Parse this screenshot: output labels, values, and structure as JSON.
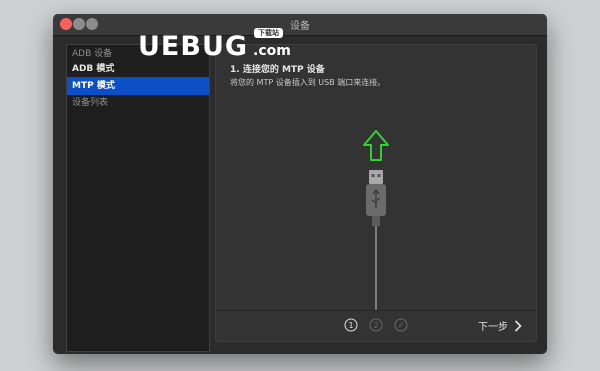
{
  "window": {
    "title": "设备"
  },
  "sidebar": {
    "items": [
      {
        "label": "ADB 设备",
        "style": "header"
      },
      {
        "label": "ADB 模式",
        "style": "bold"
      },
      {
        "label": "MTP 模式",
        "style": "selected"
      },
      {
        "label": "设备列表",
        "style": "header"
      }
    ]
  },
  "main": {
    "step_title": "1. 连接您的 MTP 设备",
    "step_description": "将您的 MTP 设备插入到 USB 端口来连接。"
  },
  "footer": {
    "steps": [
      "1",
      "2",
      "✓"
    ],
    "next_label": "下一步"
  },
  "watermark": {
    "text": "UEBUG",
    "suffix": ".com",
    "badge": "下载站"
  },
  "colors": {
    "accent": "#0d4fc7",
    "arrow": "#2fd42f",
    "close": "#fc605c"
  },
  "icons": {
    "usb": "usb-plug-icon",
    "arrow": "arrow-up-icon",
    "next": "chevron-right-icon"
  }
}
